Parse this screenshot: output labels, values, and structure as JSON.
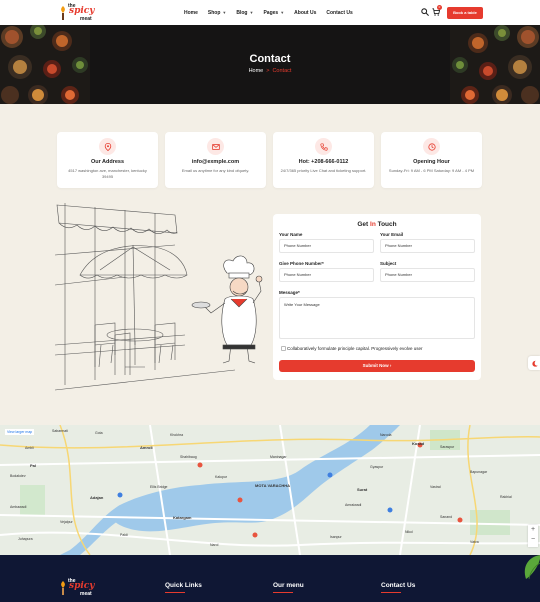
{
  "header": {
    "logo": {
      "the": "the",
      "spicy": "spicy",
      "meat": "meat"
    },
    "nav": [
      {
        "label": "Home",
        "dropdown": false
      },
      {
        "label": "Shop",
        "dropdown": true
      },
      {
        "label": "Blog",
        "dropdown": true
      },
      {
        "label": "Pages",
        "dropdown": true
      },
      {
        "label": "About Us",
        "dropdown": false
      },
      {
        "label": "Contact Us",
        "dropdown": false
      }
    ],
    "cart_count": "0",
    "book_label": "Book a table",
    "icons": [
      "search-icon",
      "cart-icon"
    ]
  },
  "hero": {
    "title": "Contact",
    "breadcrumb_home": "Home",
    "breadcrumb_sep": ">",
    "breadcrumb_current": "Contact"
  },
  "cards": [
    {
      "icon": "location-icon",
      "title": "Our Address",
      "desc": "4517 washington ave, manchester, kentucky 39495"
    },
    {
      "icon": "mail-icon",
      "title": "info@exmple.com",
      "desc": "Email us anytime for any kind ofquety."
    },
    {
      "icon": "phone-icon",
      "title": "Hot: +208-666-0112",
      "desc": "24/7/365 priority Live Chat and ticketing support."
    },
    {
      "icon": "clock-icon",
      "title": "Opening Hour",
      "desc": "Sunday-Fri: 9 AM - 6 PM Saturday: 9 AM - 4 PM"
    }
  ],
  "form": {
    "title_pre": "Get ",
    "title_red": "In",
    "title_post": " Touch",
    "name_label": "Your Name",
    "name_placeholder": "Phone Number",
    "email_label": "Your Email",
    "email_placeholder": "Phone Number",
    "phone_label": "Give Phone Number*",
    "phone_placeholder": "Phone Number",
    "subject_label": "Subject",
    "subject_placeholder": "Phone Number",
    "message_label": "Message*",
    "message_placeholder": "Write Your Message",
    "checkbox_label": "Collaboratively formulate principle capital. Progressively evolve user",
    "submit_label": "Submit Now"
  },
  "map": {
    "link": "View larger map",
    "labels": [
      "Sabarmati",
      "Gota",
      "Ambli",
      "Bodakdev",
      "Ambawadi",
      "Khokhra",
      "Naroda",
      "Saraspur",
      "Bapunagar",
      "Rakhial",
      "Vastral",
      "Nikol",
      "Vatva",
      "Isanpur",
      "Juhapura",
      "Vejalpur",
      "Paldi",
      "Shahibaug",
      "Ellis Bridge",
      "Kalupur",
      "Amraiwadi",
      "Maninagar",
      "Narol",
      "Gyaspur",
      "Sanand"
    ],
    "big_labels": [
      "MOTA\nVARACHHA",
      "Kosad",
      "Amroli",
      "Surat",
      "Pal",
      "Adajan",
      "Katargam"
    ],
    "zoom_in": "+",
    "zoom_out": "−"
  },
  "footer": {
    "col1": "Quick Links",
    "col2": "Our menu",
    "col3": "Contact Us"
  },
  "colors": {
    "accent": "#e63b2e",
    "footer": "#0f1734",
    "page_bg": "#f3efe6"
  }
}
